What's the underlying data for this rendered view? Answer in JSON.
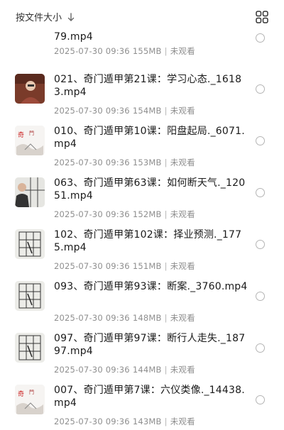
{
  "header": {
    "sort_label": "按文件大小",
    "sort_icon": "arrow-down-icon",
    "view_icon": "grid-view-icon"
  },
  "files": [
    {
      "name": "79.mp4",
      "date": "2025-07-30 09:36",
      "size": "155MB",
      "status": "未观看",
      "thumb": "whiteboard-grid"
    },
    {
      "name": "021、奇门遁甲第21课：学习心态._16183.mp4",
      "date": "2025-07-30 09:36",
      "size": "154MB",
      "status": "未观看",
      "thumb": "person"
    },
    {
      "name": "010、奇门遁甲第10课：阳盘起局._6071.mp4",
      "date": "2025-07-30 09:36",
      "size": "153MB",
      "status": "未观看",
      "thumb": "title-card"
    },
    {
      "name": "063、奇门遁甲第63课：如何断天气._12051.mp4",
      "date": "2025-07-30 09:36",
      "size": "152MB",
      "status": "未观看",
      "thumb": "person-board"
    },
    {
      "name": "102、奇门遁甲第102课：择业预测._1775.mp4",
      "date": "2025-07-30 09:36",
      "size": "151MB",
      "status": "未观看",
      "thumb": "whiteboard-grid"
    },
    {
      "name": "093、奇门遁甲第93课：断案._3760.mp4",
      "date": "2025-07-30 09:36",
      "size": "148MB",
      "status": "未观看",
      "thumb": "whiteboard-grid"
    },
    {
      "name": "097、奇门遁甲第97课：断行人走失._18797.mp4",
      "date": "2025-07-30 09:36",
      "size": "144MB",
      "status": "未观看",
      "thumb": "whiteboard-grid"
    },
    {
      "name": "007、奇门遁甲第7课：六仪类像._14438.mp4",
      "date": "2025-07-30 09:36",
      "size": "143MB",
      "status": "未观看",
      "thumb": "title-card"
    }
  ]
}
